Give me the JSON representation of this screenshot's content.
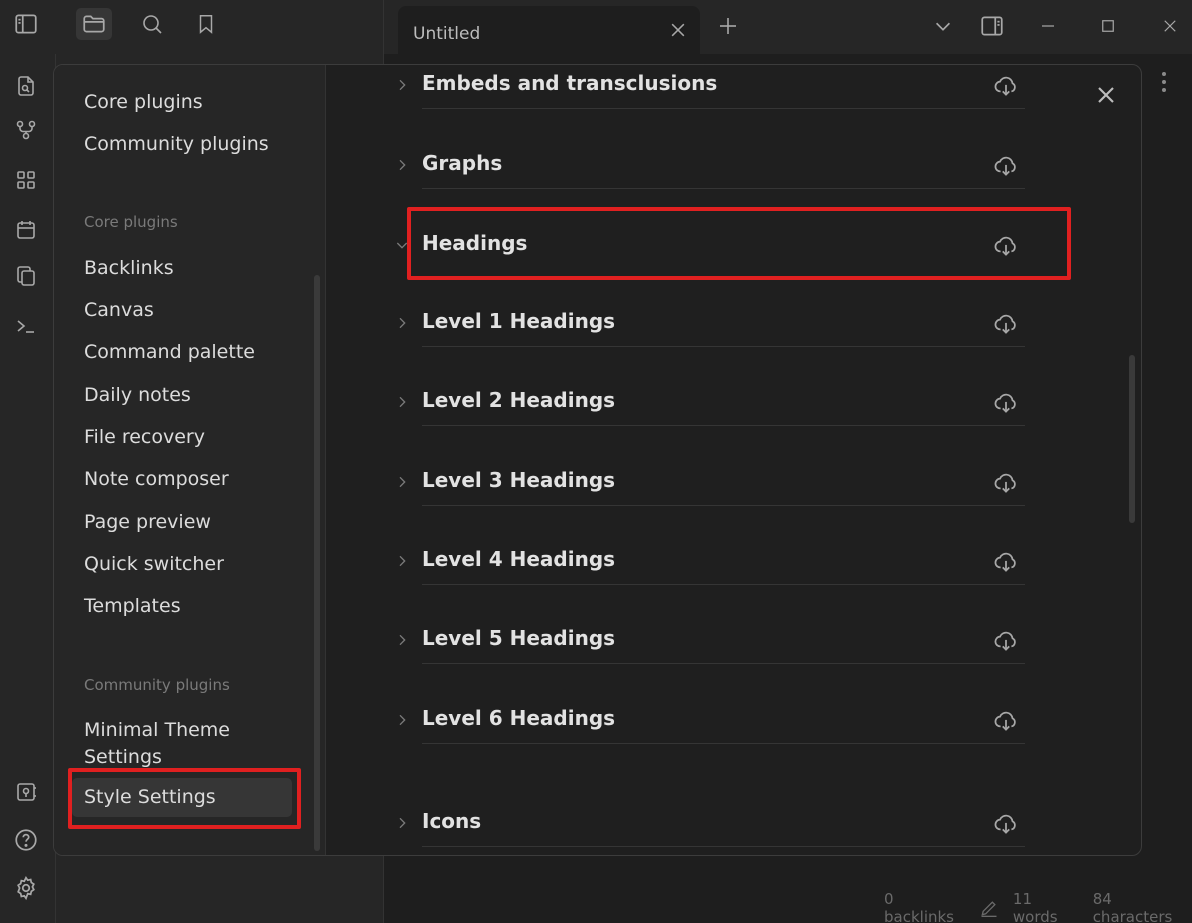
{
  "tab": {
    "title": "Untitled"
  },
  "status": {
    "backlinks": "0 backlinks",
    "words": "11 words",
    "characters": "84 characters"
  },
  "nav": {
    "options_items": [
      "Core plugins",
      "Community plugins"
    ],
    "core_heading": "Core plugins",
    "core_items": [
      "Backlinks",
      "Canvas",
      "Command palette",
      "Daily notes",
      "File recovery",
      "Note composer",
      "Page preview",
      "Quick switcher",
      "Templates"
    ],
    "community_heading": "Community plugins",
    "community_items": [
      "Minimal Theme Settings",
      "Style Settings"
    ],
    "active_item": "Style Settings"
  },
  "content": {
    "rows": [
      "Embeds and transclusions",
      "Graphs",
      "Headings",
      "Level 1 Headings",
      "Level 2 Headings",
      "Level 3 Headings",
      "Level 4 Headings",
      "Level 5 Headings",
      "Level 6 Headings",
      "Icons"
    ],
    "expanded_row": "Headings"
  },
  "colors": {
    "highlight": "#e02020",
    "background": "#1e1e1e",
    "panel": "#262626"
  },
  "icons": [
    "sidebar-toggle-icon",
    "folder-icon",
    "search-icon",
    "bookmark-icon",
    "close-icon",
    "plus-icon",
    "chevron-down-icon",
    "right-sidebar-icon",
    "minimize-icon",
    "maximize-icon",
    "file-search-icon",
    "graph-icon",
    "grid-icon",
    "calendar-icon",
    "copy-icon",
    "terminal-icon",
    "vault-icon",
    "help-icon",
    "gear-icon",
    "cloud-download-icon",
    "chevron-right-icon",
    "more-vertical-icon",
    "pencil-icon"
  ]
}
